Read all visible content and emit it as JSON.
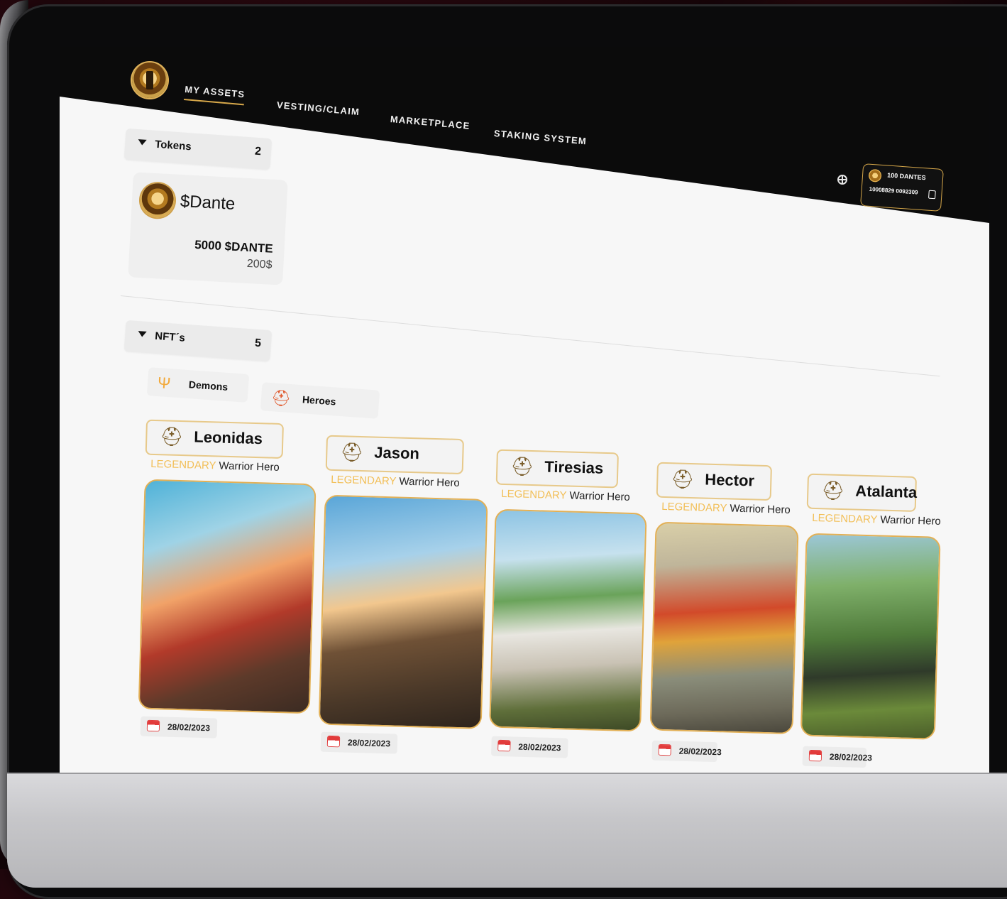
{
  "nav": {
    "items": [
      {
        "label": "MY ASSETS",
        "active": true
      },
      {
        "label": "VESTING/CLAIM",
        "active": false
      },
      {
        "label": "MARKETPLACE",
        "active": false
      },
      {
        "label": "STAKING SYSTEM",
        "active": false
      }
    ],
    "wallet": {
      "balance": "100 DANTES",
      "address": "10008829 0092309"
    },
    "icons": {
      "globe": "globe-icon",
      "copy": "copy-icon",
      "logo": "dante-logo"
    }
  },
  "tokens": {
    "label": "Tokens",
    "count": "2",
    "card": {
      "name": "$Dante",
      "amount": "5000 $DANTE",
      "usd": "200$"
    }
  },
  "nfts": {
    "label": "NFT´s",
    "count": "5",
    "filters": [
      {
        "label": "Demons",
        "icon": "trident-icon"
      },
      {
        "label": "Heroes",
        "icon": "helmet-icon"
      }
    ],
    "cards": [
      {
        "name": "Leonidas",
        "rarity": "LEGENDARY",
        "class": "Warrior Hero",
        "date": "28/02/2023"
      },
      {
        "name": "Jason",
        "rarity": "LEGENDARY",
        "class": "Warrior Hero",
        "date": "28/02/2023"
      },
      {
        "name": "Tiresias",
        "rarity": "LEGENDARY",
        "class": "Warrior Hero",
        "date": "28/02/2023"
      },
      {
        "name": "Hector",
        "rarity": "LEGENDARY",
        "class": "Warrior Hero",
        "date": "28/02/2023"
      },
      {
        "name": "Atalanta",
        "rarity": "LEGENDARY",
        "class": "Warrior Hero",
        "date": "28/02/2023"
      }
    ]
  },
  "colors": {
    "accent": "#d7a84a",
    "legendary": "#f2bf58",
    "topbar": "#0b0b0b"
  }
}
